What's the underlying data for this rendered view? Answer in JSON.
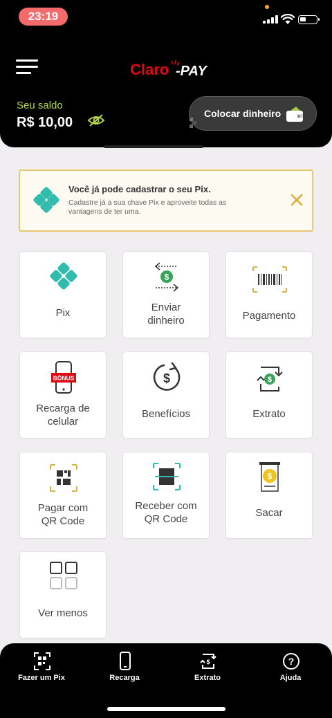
{
  "status_bar": {
    "time": "23:19"
  },
  "header": {
    "logo_text": "Claro-pay",
    "balance_label": "Seu saldo",
    "balance_value": "R$ 10,00",
    "add_money_label": "Colocar dinheiro"
  },
  "banner": {
    "title": "Você já pode cadastrar o seu Pix.",
    "text": "Cadastre já a sua chave Pix e aproveite todas as vantagens de ter uma."
  },
  "tiles": [
    {
      "label": "Pix",
      "icon": "pix-icon"
    },
    {
      "label": "Enviar dinheiro",
      "icon": "send-money-icon"
    },
    {
      "label": "Pagamento",
      "icon": "barcode-icon"
    },
    {
      "label": "Recarga de celular",
      "icon": "phone-recharge-icon",
      "badge": "BÔNUS"
    },
    {
      "label": "Benefícios",
      "icon": "benefits-icon"
    },
    {
      "label": "Extrato",
      "icon": "statement-icon"
    },
    {
      "label": "Pagar com QR Code",
      "icon": "qr-pay-icon"
    },
    {
      "label": "Receber com QR Code",
      "icon": "qr-receive-icon"
    },
    {
      "label": "Sacar",
      "icon": "withdraw-icon"
    },
    {
      "label": "Ver menos",
      "icon": "grid-icon"
    }
  ],
  "bottom_nav": [
    {
      "label": "Fazer um Pix",
      "icon": "qr-scan-icon"
    },
    {
      "label": "Recarga",
      "icon": "phone-icon"
    },
    {
      "label": "Extrato",
      "icon": "statement-icon"
    },
    {
      "label": "Ajuda",
      "icon": "help-icon"
    }
  ],
  "colors": {
    "brand_red": "#e30613",
    "balance_green": "#b8d64a",
    "pix_teal": "#32bcad",
    "banner_border": "#e8c96b",
    "gold": "#d9b24a"
  }
}
